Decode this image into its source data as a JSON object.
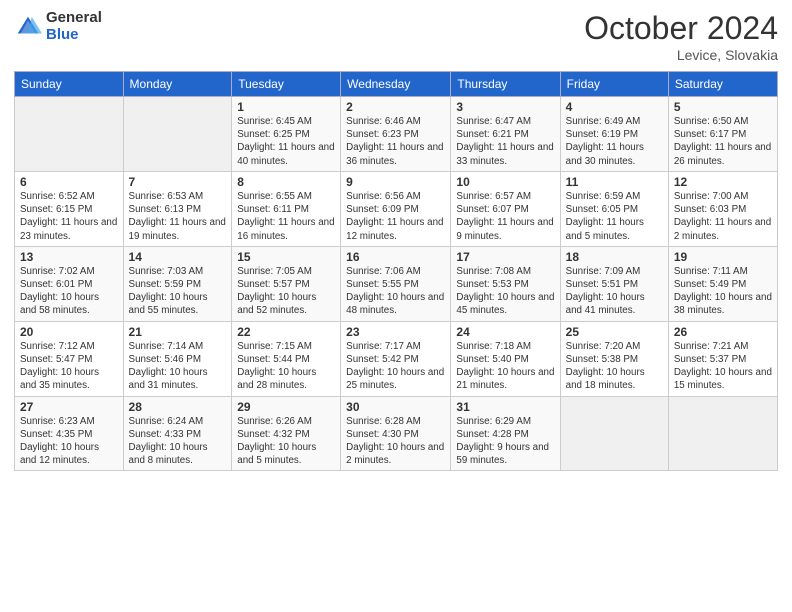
{
  "header": {
    "logo_general": "General",
    "logo_blue": "Blue",
    "month_title": "October 2024",
    "location": "Levice, Slovakia"
  },
  "weekdays": [
    "Sunday",
    "Monday",
    "Tuesday",
    "Wednesday",
    "Thursday",
    "Friday",
    "Saturday"
  ],
  "weeks": [
    [
      {
        "day": "",
        "info": ""
      },
      {
        "day": "",
        "info": ""
      },
      {
        "day": "1",
        "info": "Sunrise: 6:45 AM\nSunset: 6:25 PM\nDaylight: 11 hours and 40 minutes."
      },
      {
        "day": "2",
        "info": "Sunrise: 6:46 AM\nSunset: 6:23 PM\nDaylight: 11 hours and 36 minutes."
      },
      {
        "day": "3",
        "info": "Sunrise: 6:47 AM\nSunset: 6:21 PM\nDaylight: 11 hours and 33 minutes."
      },
      {
        "day": "4",
        "info": "Sunrise: 6:49 AM\nSunset: 6:19 PM\nDaylight: 11 hours and 30 minutes."
      },
      {
        "day": "5",
        "info": "Sunrise: 6:50 AM\nSunset: 6:17 PM\nDaylight: 11 hours and 26 minutes."
      }
    ],
    [
      {
        "day": "6",
        "info": "Sunrise: 6:52 AM\nSunset: 6:15 PM\nDaylight: 11 hours and 23 minutes."
      },
      {
        "day": "7",
        "info": "Sunrise: 6:53 AM\nSunset: 6:13 PM\nDaylight: 11 hours and 19 minutes."
      },
      {
        "day": "8",
        "info": "Sunrise: 6:55 AM\nSunset: 6:11 PM\nDaylight: 11 hours and 16 minutes."
      },
      {
        "day": "9",
        "info": "Sunrise: 6:56 AM\nSunset: 6:09 PM\nDaylight: 11 hours and 12 minutes."
      },
      {
        "day": "10",
        "info": "Sunrise: 6:57 AM\nSunset: 6:07 PM\nDaylight: 11 hours and 9 minutes."
      },
      {
        "day": "11",
        "info": "Sunrise: 6:59 AM\nSunset: 6:05 PM\nDaylight: 11 hours and 5 minutes."
      },
      {
        "day": "12",
        "info": "Sunrise: 7:00 AM\nSunset: 6:03 PM\nDaylight: 11 hours and 2 minutes."
      }
    ],
    [
      {
        "day": "13",
        "info": "Sunrise: 7:02 AM\nSunset: 6:01 PM\nDaylight: 10 hours and 58 minutes."
      },
      {
        "day": "14",
        "info": "Sunrise: 7:03 AM\nSunset: 5:59 PM\nDaylight: 10 hours and 55 minutes."
      },
      {
        "day": "15",
        "info": "Sunrise: 7:05 AM\nSunset: 5:57 PM\nDaylight: 10 hours and 52 minutes."
      },
      {
        "day": "16",
        "info": "Sunrise: 7:06 AM\nSunset: 5:55 PM\nDaylight: 10 hours and 48 minutes."
      },
      {
        "day": "17",
        "info": "Sunrise: 7:08 AM\nSunset: 5:53 PM\nDaylight: 10 hours and 45 minutes."
      },
      {
        "day": "18",
        "info": "Sunrise: 7:09 AM\nSunset: 5:51 PM\nDaylight: 10 hours and 41 minutes."
      },
      {
        "day": "19",
        "info": "Sunrise: 7:11 AM\nSunset: 5:49 PM\nDaylight: 10 hours and 38 minutes."
      }
    ],
    [
      {
        "day": "20",
        "info": "Sunrise: 7:12 AM\nSunset: 5:47 PM\nDaylight: 10 hours and 35 minutes."
      },
      {
        "day": "21",
        "info": "Sunrise: 7:14 AM\nSunset: 5:46 PM\nDaylight: 10 hours and 31 minutes."
      },
      {
        "day": "22",
        "info": "Sunrise: 7:15 AM\nSunset: 5:44 PM\nDaylight: 10 hours and 28 minutes."
      },
      {
        "day": "23",
        "info": "Sunrise: 7:17 AM\nSunset: 5:42 PM\nDaylight: 10 hours and 25 minutes."
      },
      {
        "day": "24",
        "info": "Sunrise: 7:18 AM\nSunset: 5:40 PM\nDaylight: 10 hours and 21 minutes."
      },
      {
        "day": "25",
        "info": "Sunrise: 7:20 AM\nSunset: 5:38 PM\nDaylight: 10 hours and 18 minutes."
      },
      {
        "day": "26",
        "info": "Sunrise: 7:21 AM\nSunset: 5:37 PM\nDaylight: 10 hours and 15 minutes."
      }
    ],
    [
      {
        "day": "27",
        "info": "Sunrise: 6:23 AM\nSunset: 4:35 PM\nDaylight: 10 hours and 12 minutes."
      },
      {
        "day": "28",
        "info": "Sunrise: 6:24 AM\nSunset: 4:33 PM\nDaylight: 10 hours and 8 minutes."
      },
      {
        "day": "29",
        "info": "Sunrise: 6:26 AM\nSunset: 4:32 PM\nDaylight: 10 hours and 5 minutes."
      },
      {
        "day": "30",
        "info": "Sunrise: 6:28 AM\nSunset: 4:30 PM\nDaylight: 10 hours and 2 minutes."
      },
      {
        "day": "31",
        "info": "Sunrise: 6:29 AM\nSunset: 4:28 PM\nDaylight: 9 hours and 59 minutes."
      },
      {
        "day": "",
        "info": ""
      },
      {
        "day": "",
        "info": ""
      }
    ]
  ]
}
